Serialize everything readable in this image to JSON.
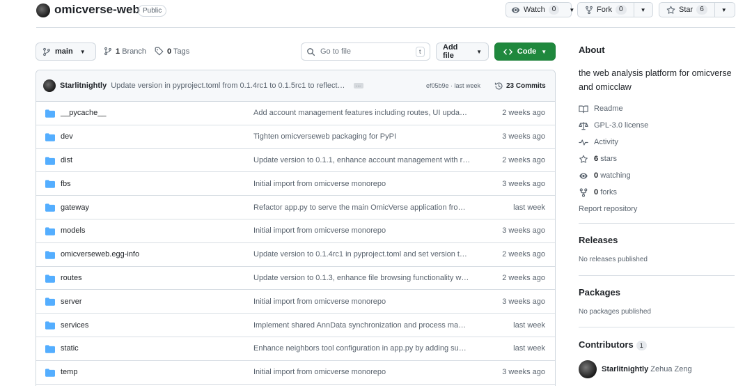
{
  "repo": {
    "name": "omicverse-web",
    "visibility": "Public"
  },
  "header_actions": {
    "watch_label": "Watch",
    "watch_count": "0",
    "fork_label": "Fork",
    "fork_count": "0",
    "star_label": "Star",
    "star_count": "6"
  },
  "toolbar": {
    "branch": "main",
    "branches_count": "1",
    "branches_label": "Branch",
    "tags_count": "0",
    "tags_label": "Tags",
    "search_placeholder": "Go to file",
    "search_shortcut": "t",
    "add_file_label": "Add file",
    "code_label": "Code"
  },
  "latest_commit": {
    "author": "Starlitnightly",
    "message": "Update version in pyproject.toml from 0.1.4rc1 to 0.1.5rc1 to reflect…",
    "hash_time": "ef05b9e · last week",
    "commits_count": "23 Commits"
  },
  "files": [
    {
      "name": "__pycache__",
      "message": "Add account management features including routes, UI upda…",
      "date": "2 weeks ago"
    },
    {
      "name": "dev",
      "message": "Tighten omicverseweb packaging for PyPI",
      "date": "3 weeks ago"
    },
    {
      "name": "dist",
      "message": "Update version to 0.1.1, enhance account management with r…",
      "date": "2 weeks ago"
    },
    {
      "name": "fbs",
      "message": "Initial import from omicverse monorepo",
      "date": "3 weeks ago"
    },
    {
      "name": "gateway",
      "message": "Refactor app.py to serve the main OmicVerse application fro…",
      "date": "last week"
    },
    {
      "name": "models",
      "message": "Initial import from omicverse monorepo",
      "date": "3 weeks ago"
    },
    {
      "name": "omicverseweb.egg-info",
      "message": "Update version to 0.1.4rc1 in pyproject.toml and set version t…",
      "date": "2 weeks ago"
    },
    {
      "name": "routes",
      "message": "Update version to 0.1.3, enhance file browsing functionality w…",
      "date": "2 weeks ago"
    },
    {
      "name": "server",
      "message": "Initial import from omicverse monorepo",
      "date": "3 weeks ago"
    },
    {
      "name": "services",
      "message": "Implement shared AnnData synchronization and process ma…",
      "date": "last week"
    },
    {
      "name": "static",
      "message": "Enhance neighbors tool configuration in app.py by adding su…",
      "date": "last week"
    },
    {
      "name": "temp",
      "message": "Initial import from omicverse monorepo",
      "date": "3 weeks ago"
    }
  ],
  "about": {
    "title": "About",
    "description": "the web analysis platform for omicverse and omicclaw",
    "readme": "Readme",
    "license": "GPL-3.0 license",
    "activity": "Activity",
    "stars_count": "6",
    "stars_label": "stars",
    "watching_count": "0",
    "watching_label": "watching",
    "forks_count": "0",
    "forks_label": "forks",
    "report": "Report repository"
  },
  "releases": {
    "title": "Releases",
    "note": "No releases published"
  },
  "packages": {
    "title": "Packages",
    "note": "No packages published"
  },
  "contributors": {
    "title": "Contributors",
    "count": "1",
    "login": "Starlitnightly",
    "full_name": "Zehua Zeng"
  },
  "colors": {
    "code_button": "#1f883d",
    "folder_icon": "#54aeff",
    "border": "#d0d7de"
  }
}
